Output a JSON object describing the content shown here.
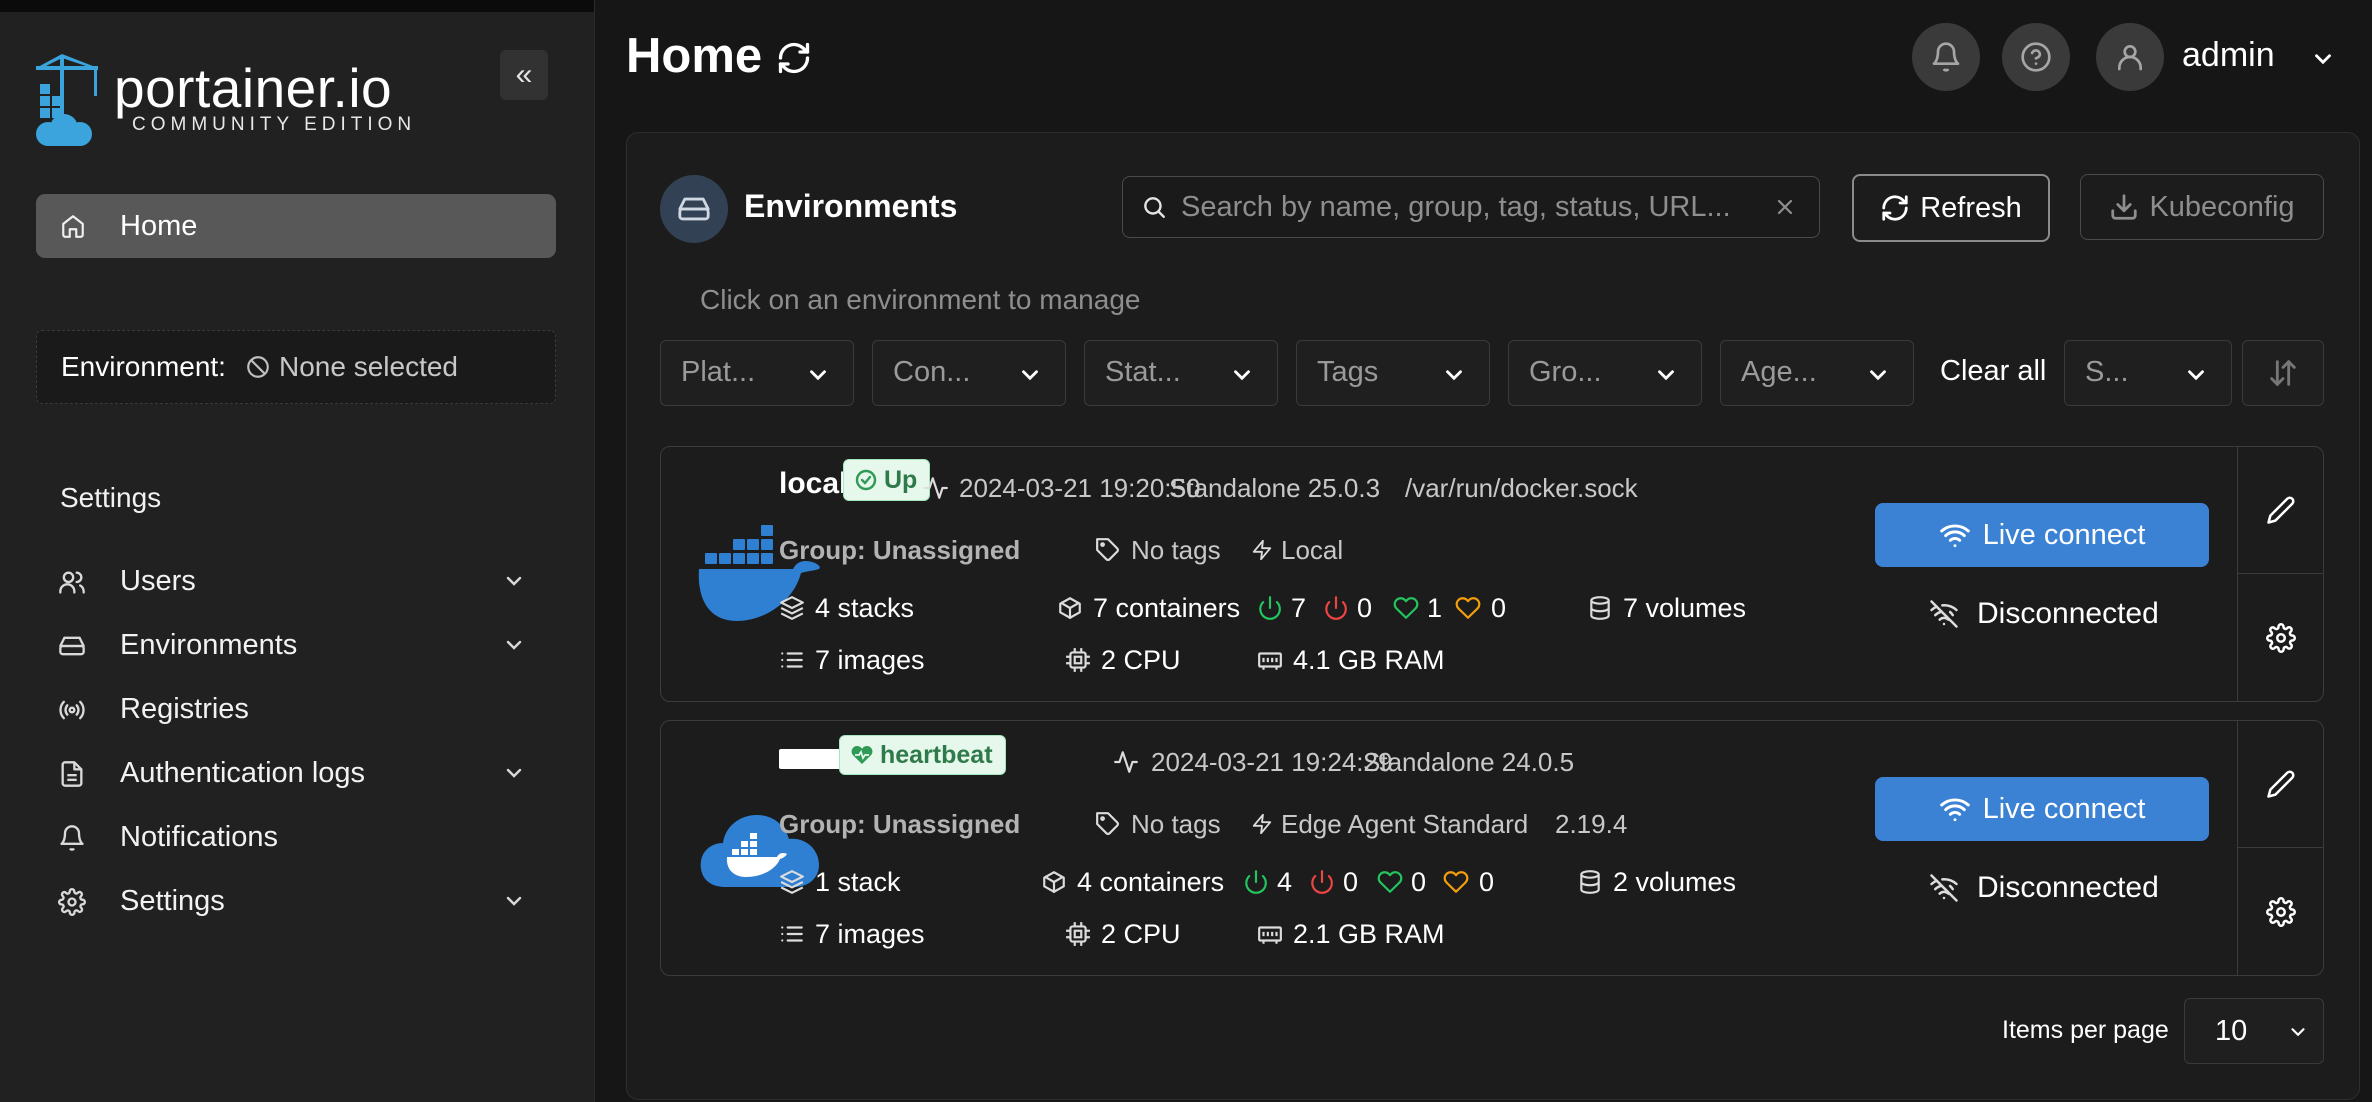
{
  "sidebar": {
    "brand_name": "portainer.io",
    "brand_edition": "COMMUNITY EDITION",
    "collapse_label": "«",
    "home_label": "Home",
    "environment_key": "Environment:",
    "environment_value": "None selected",
    "settings_heading": "Settings",
    "items": [
      {
        "label": "Users",
        "icon": "users-icon",
        "expandable": true
      },
      {
        "label": "Environments",
        "icon": "hard-drive-icon",
        "expandable": true
      },
      {
        "label": "Registries",
        "icon": "radio-icon",
        "expandable": false
      },
      {
        "label": "Authentication logs",
        "icon": "file-text-icon",
        "expandable": true
      },
      {
        "label": "Notifications",
        "icon": "bell-icon",
        "expandable": false
      },
      {
        "label": "Settings",
        "icon": "gear-icon",
        "expandable": true
      }
    ]
  },
  "header": {
    "title": "Home",
    "username": "admin"
  },
  "environments": {
    "title": "Environments",
    "search_placeholder": "Search by name, group, tag, status, URL...",
    "refresh_label": "Refresh",
    "kubeconfig_label": "Kubeconfig",
    "hint": "Click on an environment to manage",
    "filters": [
      "Plat...",
      "Con...",
      "Stat...",
      "Tags",
      "Gro...",
      "Age..."
    ],
    "clear_all": "Clear all",
    "sort_label": "S...",
    "cards": [
      {
        "name": "local",
        "status": "Up",
        "timestamp": "2024-03-21 19:20:50",
        "type": "Standalone 25.0.3",
        "url": "/var/run/docker.sock",
        "group": "Group: Unassigned",
        "tags": "No tags",
        "kind": "Local",
        "stacks": "4 stacks",
        "containers": "7 containers",
        "running": "7",
        "stopped": "0",
        "healthy": "1",
        "unhealthy": "0",
        "volumes": "7 volumes",
        "images": "7 images",
        "cpu": "2 CPU",
        "ram": "4.1 GB RAM",
        "live_connect": "Live connect",
        "connection": "Disconnected"
      },
      {
        "name": "",
        "status": "heartbeat",
        "timestamp": "2024-03-21 19:24:29",
        "type": "Standalone 24.0.5",
        "group": "Group: Unassigned",
        "tags": "No tags",
        "kind": "Edge Agent Standard",
        "agent_version": "2.19.4",
        "stacks": "1 stack",
        "containers": "4 containers",
        "running": "4",
        "stopped": "0",
        "healthy": "0",
        "unhealthy": "0",
        "volumes": "2 volumes",
        "images": "7 images",
        "cpu": "2 CPU",
        "ram": "2.1 GB RAM",
        "live_connect": "Live connect",
        "connection": "Disconnected"
      }
    ],
    "items_per_page_label": "Items per page",
    "items_per_page": "10"
  },
  "colors": {
    "accent_blue": "#3b82d4",
    "status_green": "#2f7a4a",
    "running_green": "#22c55e",
    "stopped_red": "#ef4444",
    "unhealthy_orange": "#f59e0b"
  }
}
